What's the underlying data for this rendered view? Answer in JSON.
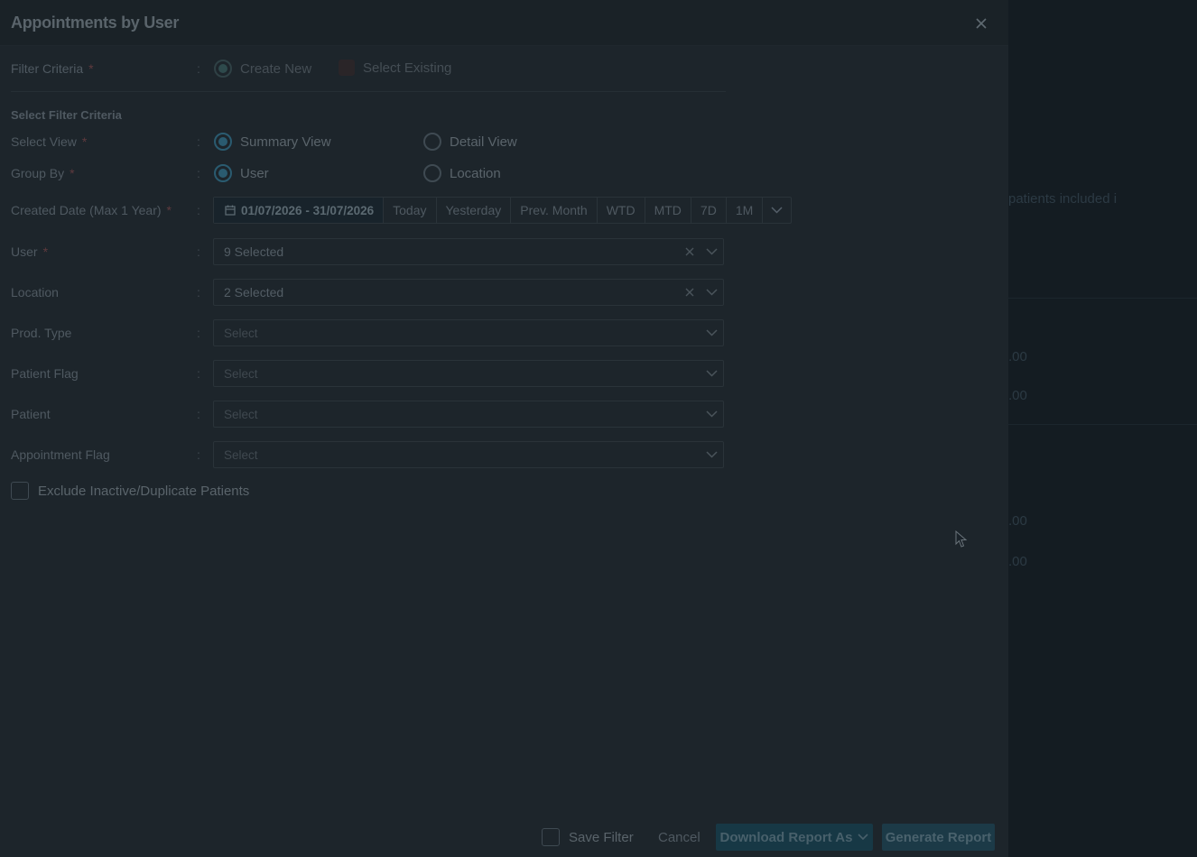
{
  "panel": {
    "title": "Appointments by User",
    "close_symbol": "×"
  },
  "filter_criteria": {
    "label": "Filter Criteria",
    "required": "*",
    "options": [
      "Create New",
      "Select Existing"
    ],
    "selected": "Create New"
  },
  "section_title": "Select Filter Criteria",
  "select_view": {
    "label": "Select View",
    "required": "*",
    "options": [
      "Summary View",
      "Detail View"
    ],
    "selected": "Summary View"
  },
  "group_by": {
    "label": "Group By",
    "required": "*",
    "options": [
      "User",
      "Location"
    ],
    "selected": "User"
  },
  "created_date": {
    "label": "Created Date (Max 1 Year)",
    "required": "*",
    "range": "01/07/2026 - 31/07/2026",
    "presets": [
      "Today",
      "Yesterday",
      "Prev. Month",
      "WTD",
      "MTD",
      "7D",
      "1M"
    ]
  },
  "fields": {
    "user": {
      "label": "User",
      "required": "*",
      "value": "9 Selected"
    },
    "location": {
      "label": "Location",
      "value": "2 Selected"
    },
    "prod_type": {
      "label": "Prod. Type",
      "placeholder": "Select"
    },
    "patient_flag": {
      "label": "Patient Flag",
      "placeholder": "Select"
    },
    "patient": {
      "label": "Patient",
      "placeholder": "Select"
    },
    "appointment_flag": {
      "label": "Appointment Flag",
      "placeholder": "Select"
    }
  },
  "exclude_inactive": {
    "label": "Exclude Inactive/Duplicate Patients",
    "checked": false
  },
  "footer": {
    "save_filter": "Save Filter",
    "cancel": "Cancel",
    "download": "Download Report As",
    "generate": "Generate Report"
  },
  "background": {
    "snippet_1": "patients included i",
    "values": [
      ".00",
      ".00",
      ".00",
      ".00"
    ]
  },
  "colon": ":"
}
